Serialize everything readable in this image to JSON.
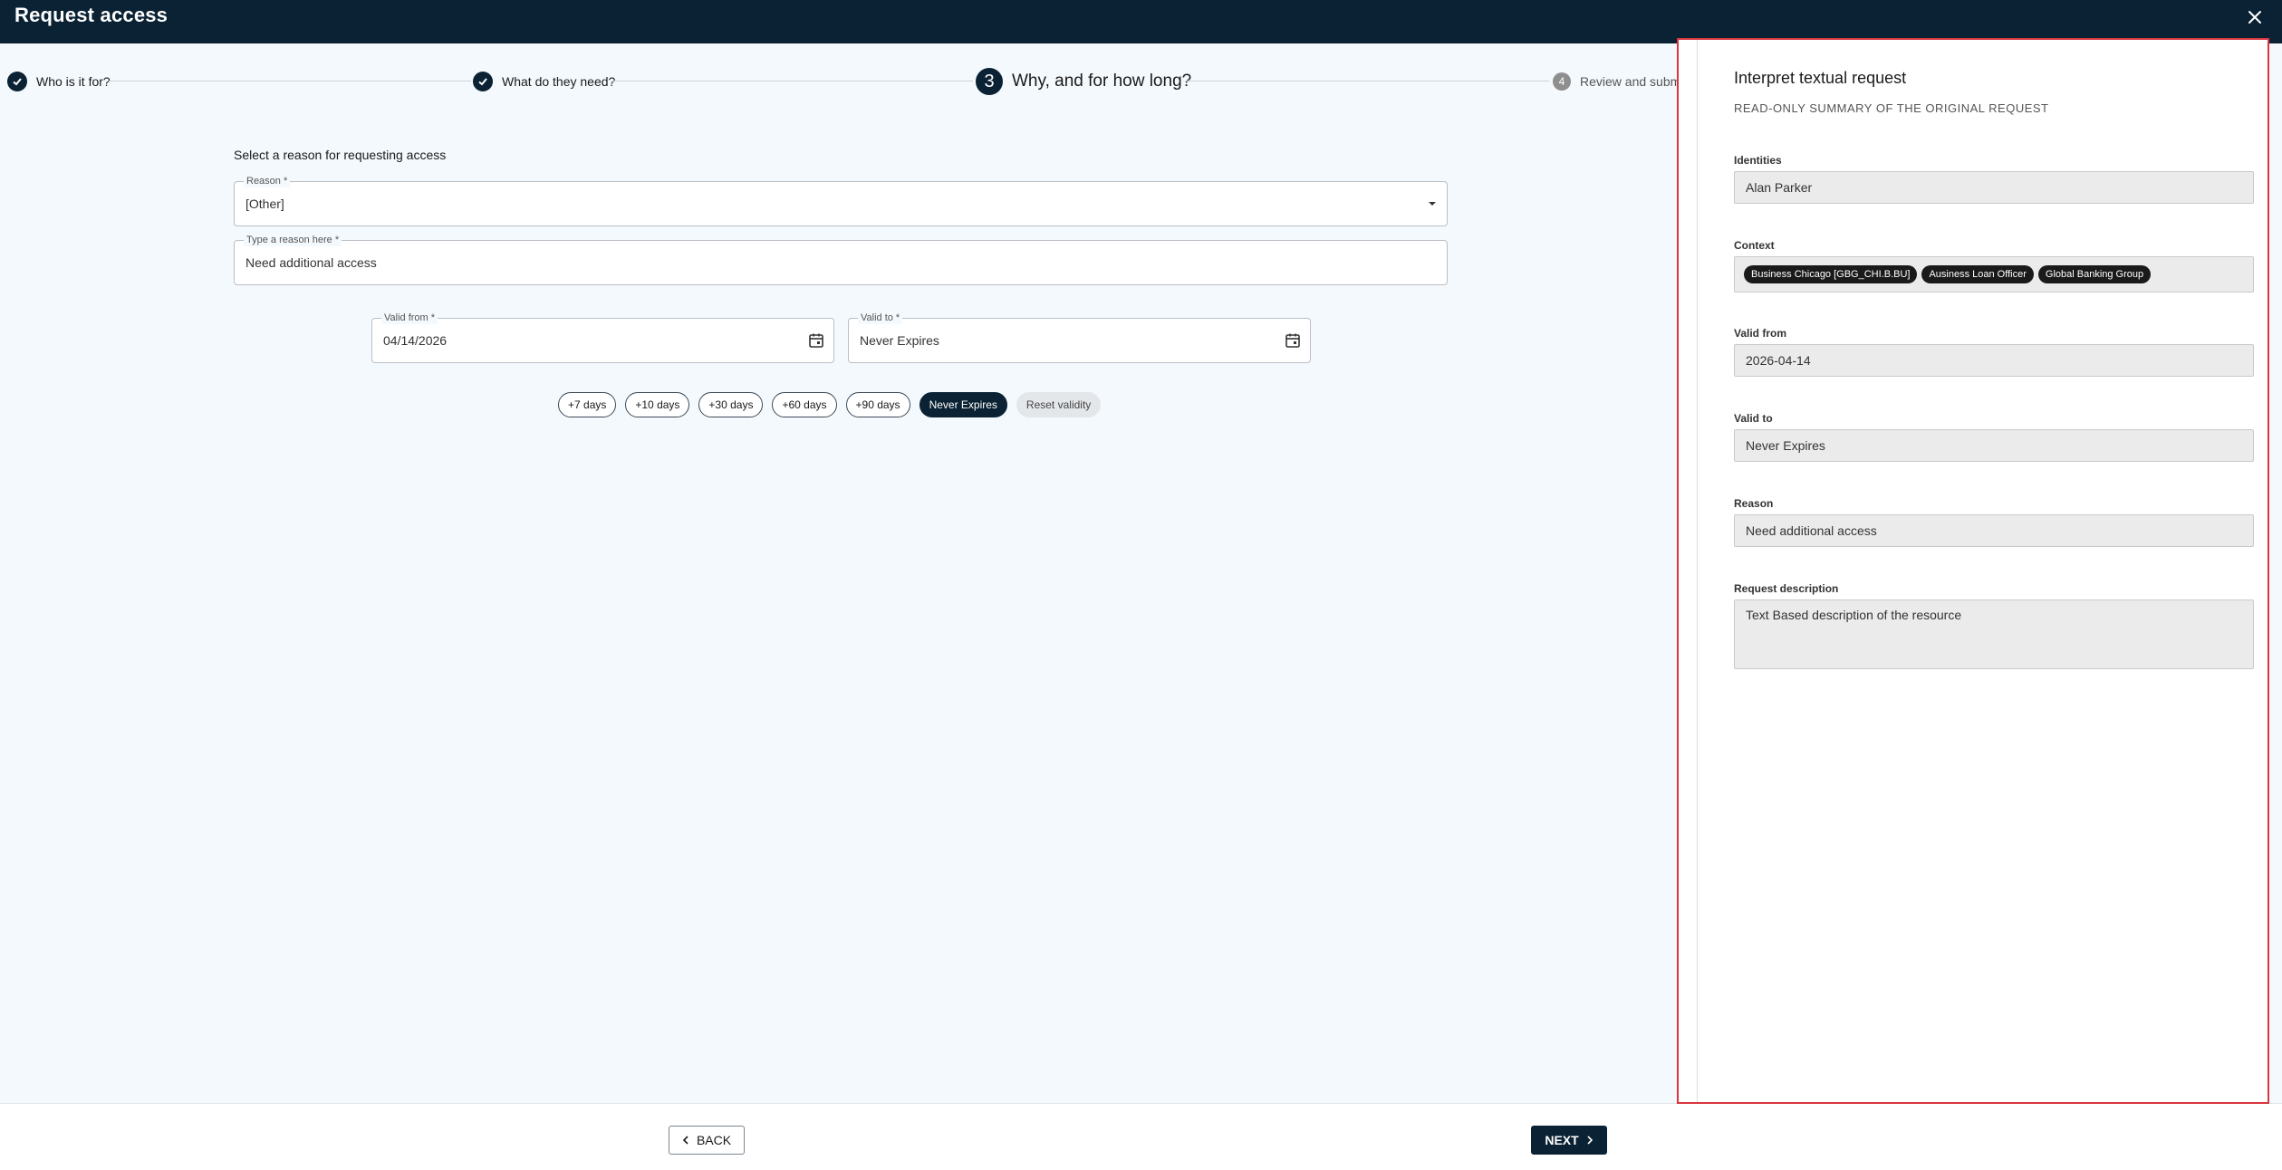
{
  "header": {
    "title": "Request access"
  },
  "stepper": {
    "steps": [
      {
        "number": "",
        "label": "Who is it for?"
      },
      {
        "number": "",
        "label": "What do they need?"
      },
      {
        "number": "3",
        "label": "Why, and for how long?"
      },
      {
        "number": "4",
        "label": "Review and submit"
      }
    ]
  },
  "form": {
    "section_label": "Select a reason for requesting access",
    "reason": {
      "label": "Reason *",
      "value": "[Other]"
    },
    "reason_text": {
      "label": "Type a reason here *",
      "value": "Need additional access"
    },
    "valid_from": {
      "label": "Valid from *",
      "value": "04/14/2026"
    },
    "valid_to": {
      "label": "Valid to *",
      "value": "Never Expires"
    },
    "chips": [
      {
        "label": "+7 days"
      },
      {
        "label": "+10 days"
      },
      {
        "label": "+30 days"
      },
      {
        "label": "+60 days"
      },
      {
        "label": "+90 days"
      },
      {
        "label": "Never Expires"
      },
      {
        "label": "Reset validity"
      }
    ]
  },
  "footer": {
    "back_label": "BACK",
    "next_label": "NEXT"
  },
  "panel": {
    "title": "Interpret textual request",
    "subtitle": "READ-ONLY SUMMARY OF THE ORIGINAL REQUEST",
    "identities": {
      "label": "Identities",
      "value": "Alan Parker"
    },
    "context": {
      "label": "Context",
      "tags": [
        "Business Chicago [GBG_CHI.B.BU]",
        "Ausiness Loan Officer",
        "Global Banking Group"
      ]
    },
    "valid_from": {
      "label": "Valid from",
      "value": "2026-04-14"
    },
    "valid_to": {
      "label": "Valid to",
      "value": "Never Expires"
    },
    "reason": {
      "label": "Reason",
      "value": "Need additional access"
    },
    "description": {
      "label": "Request description",
      "value": "Text Based description of the resource"
    }
  },
  "colors": {
    "header_bg": "#0a2233",
    "accent": "#0a2233",
    "highlight_border": "#d9363e"
  }
}
